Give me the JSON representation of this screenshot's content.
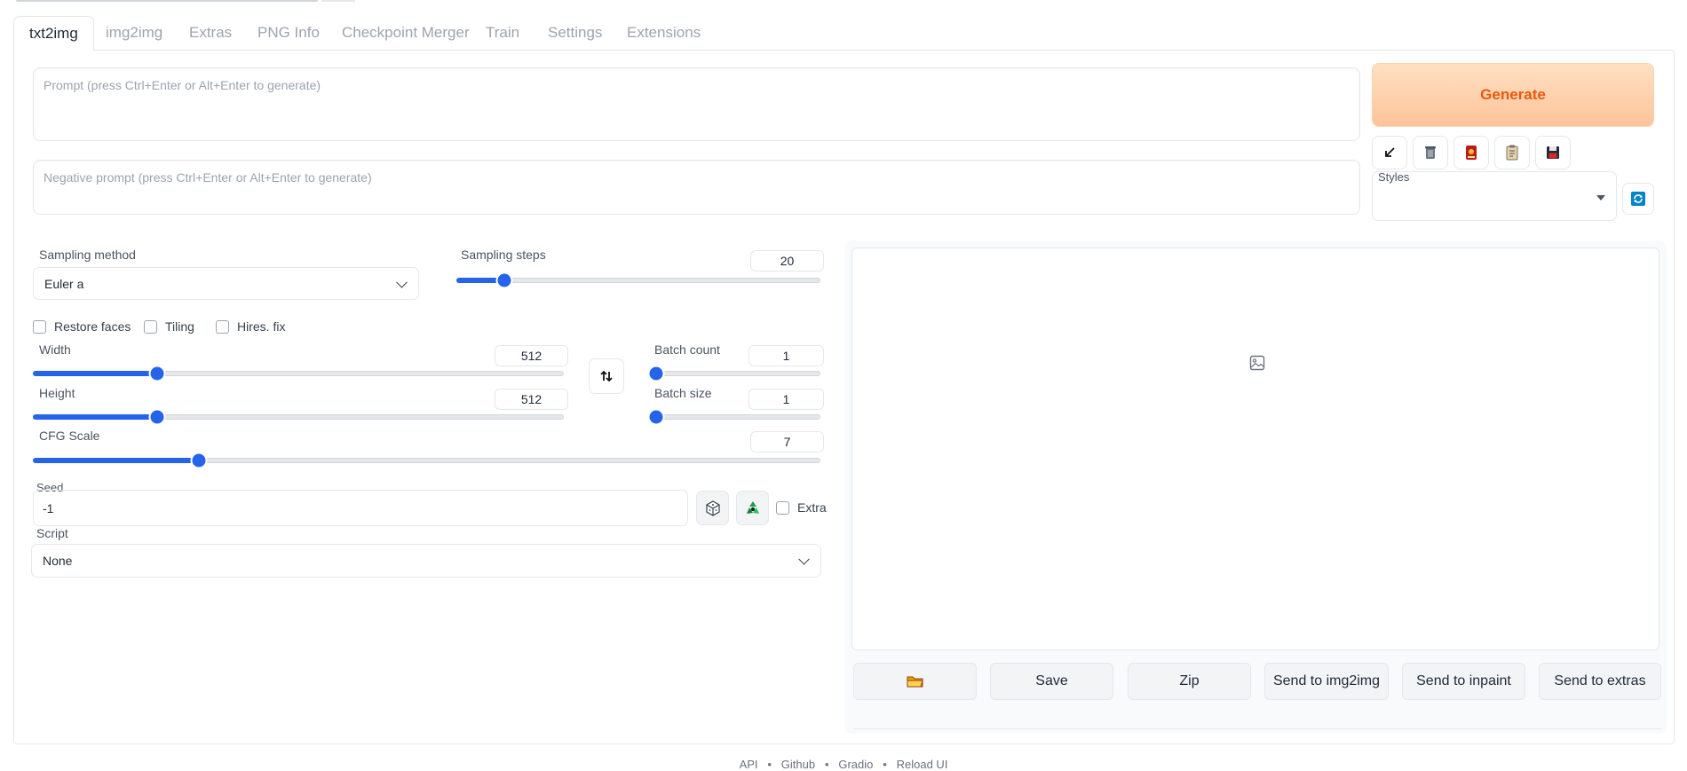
{
  "tabs": [
    "txt2img",
    "img2img",
    "Extras",
    "PNG Info",
    "Checkpoint Merger",
    "Train",
    "Settings",
    "Extensions"
  ],
  "prompt": {
    "placeholder": "Prompt (press Ctrl+Enter or Alt+Enter to generate)",
    "value": ""
  },
  "negative_prompt": {
    "placeholder": "Negative prompt (press Ctrl+Enter or Alt+Enter to generate)",
    "value": ""
  },
  "generate_label": "Generate",
  "tool_icons": [
    "arrow-down-left-icon",
    "trash-icon",
    "red-card-icon",
    "clipboard-icon",
    "floppy-disk-icon"
  ],
  "styles": {
    "label": "Styles",
    "value": ""
  },
  "sampling_method": {
    "label": "Sampling method",
    "value": "Euler a"
  },
  "sampling_steps": {
    "label": "Sampling steps",
    "value": "20",
    "fraction": 0.13
  },
  "checkboxes": {
    "restore_faces": "Restore faces",
    "tiling": "Tiling",
    "hires_fix": "Hires. fix",
    "extra": "Extra"
  },
  "width": {
    "label": "Width",
    "value": "512",
    "fraction": 0.233
  },
  "height": {
    "label": "Height",
    "value": "512",
    "fraction": 0.233
  },
  "batch_count": {
    "label": "Batch count",
    "value": "1",
    "fraction": 0.0
  },
  "batch_size": {
    "label": "Batch size",
    "value": "1",
    "fraction": 0.0
  },
  "cfg_scale": {
    "label": "CFG Scale",
    "value": "7",
    "fraction": 0.21
  },
  "seed": {
    "label": "Seed",
    "value": "-1"
  },
  "script": {
    "label": "Script",
    "value": "None"
  },
  "actions": {
    "folder_icon": "folder-icon",
    "save": "Save",
    "zip": "Zip",
    "send_img2img": "Send to img2img",
    "send_inpaint": "Send to inpaint",
    "send_extras": "Send to extras"
  },
  "footer": [
    "API",
    "Github",
    "Gradio",
    "Reload UI"
  ],
  "colors": {
    "accent": "#2563eb",
    "generate_text": "#ea580c",
    "generate_bg": "#fdc49a"
  }
}
